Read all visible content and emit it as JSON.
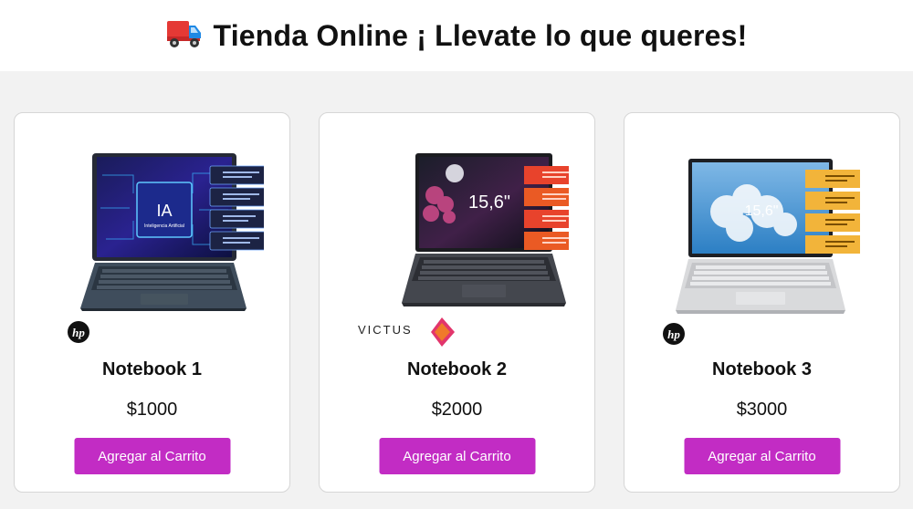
{
  "header": {
    "title": "Tienda Online ¡ Llevate lo que queres!",
    "icon": "delivery-truck-icon"
  },
  "colors": {
    "accent": "#c22cc4",
    "background": "#f2f2f2",
    "card": "#ffffff"
  },
  "products": [
    {
      "name": "Notebook 1",
      "price": "$1000",
      "button_label": "Agregar al Carrito",
      "brand_icon": "hp-logo-icon",
      "screen_text": "IA",
      "screen_subtext": "Inteligencia Artificial"
    },
    {
      "name": "Notebook 2",
      "price": "$2000",
      "button_label": "Agregar al Carrito",
      "brand_icon": "victus-omen-logo-icon",
      "brand_text": "VICTUS",
      "screen_text": "15,6\""
    },
    {
      "name": "Notebook 3",
      "price": "$3000",
      "button_label": "Agregar al Carrito",
      "brand_icon": "hp-logo-icon",
      "screen_text": "15,6\""
    }
  ]
}
